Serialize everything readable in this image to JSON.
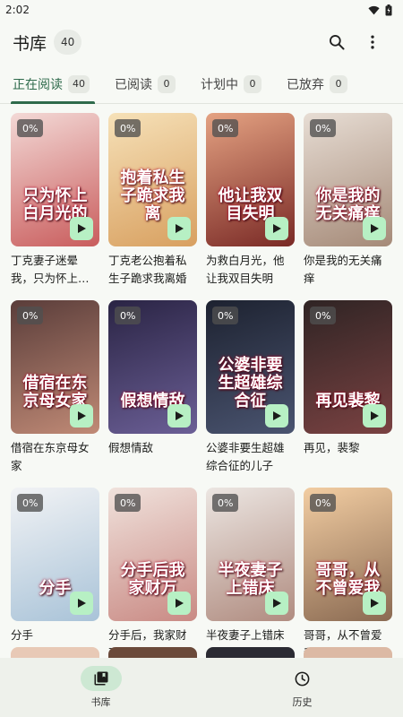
{
  "status_bar": {
    "time": "2:02"
  },
  "app_bar": {
    "title": "书库",
    "count": "40"
  },
  "tabs": [
    {
      "label": "正在阅读",
      "count": "40",
      "active": true
    },
    {
      "label": "已阅读",
      "count": "0"
    },
    {
      "label": "计划中",
      "count": "0"
    },
    {
      "label": "已放弃",
      "count": "0"
    }
  ],
  "books": [
    {
      "title": "丁克妻子迷晕我，只为怀上白月光的孩子",
      "cover_text": "只为怀上白月光的",
      "progress": "0%",
      "colors": [
        "#f3d9d6",
        "#c95d5d"
      ]
    },
    {
      "title": "丁克老公抱着私生子跪求我离婚",
      "cover_text": "抱着私生子跪求我离",
      "progress": "0%",
      "colors": [
        "#f6e1b8",
        "#d8a060"
      ]
    },
    {
      "title": "为救白月光，他让我双目失明",
      "cover_text": "他让我双目失明",
      "progress": "0%",
      "colors": [
        "#e4a282",
        "#7a2a26"
      ]
    },
    {
      "title": "你是我的无关痛痒",
      "cover_text": "你是我的无关痛痒",
      "progress": "0%",
      "colors": [
        "#e7ddd4",
        "#a58a78"
      ]
    },
    {
      "title": "借宿在东京母女家",
      "cover_text": "借宿在东京母女家",
      "progress": "0%",
      "colors": [
        "#5a3d3a",
        "#c08a76"
      ]
    },
    {
      "title": "假想情敌",
      "cover_text": "假想情敌",
      "progress": "0%",
      "colors": [
        "#2a2444",
        "#6b5f96"
      ]
    },
    {
      "title": "公婆非要生超雄综合征的儿子",
      "cover_text": "公婆非要生超雄综合征",
      "progress": "0%",
      "colors": [
        "#1d2230",
        "#4a5470"
      ]
    },
    {
      "title": "再见，裴黎",
      "cover_text": "再见裴黎",
      "progress": "0%",
      "colors": [
        "#2f2424",
        "#7a4242"
      ]
    },
    {
      "title": "分手",
      "cover_text": "分手",
      "progress": "0%",
      "colors": [
        "#f2f3f5",
        "#a9c3d8"
      ]
    },
    {
      "title": "分手后，我家财万贯",
      "cover_text": "分手后我家财万",
      "progress": "0%",
      "colors": [
        "#f0e2dc",
        "#c98a84"
      ]
    },
    {
      "title": "半夜妻子上错床",
      "cover_text": "半夜妻子上错床",
      "progress": "0%",
      "colors": [
        "#ece6e2",
        "#b08c80"
      ]
    },
    {
      "title": "哥哥，从不曾爱我",
      "cover_text": "哥哥，从不曾爱我",
      "progress": "0%",
      "colors": [
        "#f2cda2",
        "#8a6a52"
      ]
    }
  ],
  "partial_colors": [
    "#e8c9b6",
    "#6b4a3a",
    "#2b2b33",
    "#dcb9a4"
  ],
  "bottom_nav": [
    {
      "label": "书库",
      "icon": "library-icon",
      "active": true
    },
    {
      "label": "历史",
      "icon": "history-icon",
      "active": false
    }
  ],
  "colors": {
    "accent": "#2e6a4b",
    "play_button": "#b7f0c4"
  }
}
